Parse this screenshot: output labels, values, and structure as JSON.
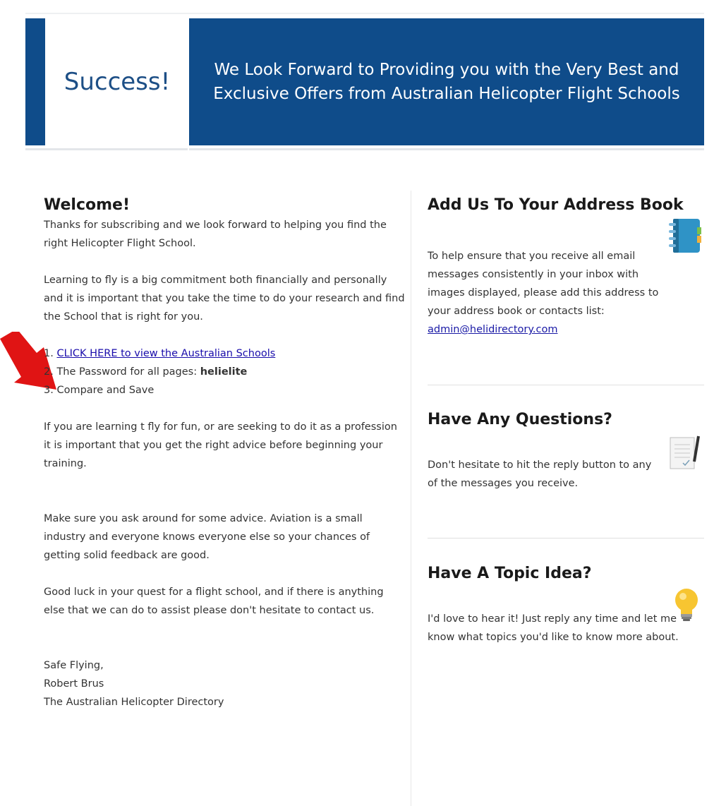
{
  "header": {
    "success": "Success!",
    "banner": "We Look Forward to Providing you with the Very Best and Exclusive Offers from Australian Helicopter Flight Schools"
  },
  "left": {
    "heading": "Welcome!",
    "p1": "Thanks for subscribing and we look forward to helping you find the right Helicopter Flight School.",
    "p2": "Learning to fly is a big commitment both financially and personally and it is important that you take the time to do your research and find the School that is right for you.",
    "list": {
      "item1_num": "1. ",
      "item1_link": "CLICK HERE to view the Australian Schools",
      "item2_text": "2. The Password for all pages: ",
      "item2_bold": "helielite",
      "item3": "3. Compare and Save"
    },
    "p3": "If you are learning t fly for fun, or are seeking to do it as a profession it is important that you get the right advice before beginning your training.",
    "p4": "Make sure you ask around for some advice. Aviation is a small industry and everyone knows everyone else so your chances of getting solid feedback are good.",
    "p5": "Good luck in your quest for a flight school, and if there is anything else that we can do to assist please don't hesitate to contact us.",
    "sign1": "Safe Flying,",
    "sign2": "Robert Brus",
    "sign3": "The Australian Helicopter Directory"
  },
  "right": {
    "address": {
      "heading": "Add Us To Your Address Book",
      "text": "To help ensure that you receive all email messages consistently in your inbox with images displayed, please add this address to your address book or contacts list: ",
      "email": "admin@helidirectory.com",
      "icon": "address-book-icon"
    },
    "questions": {
      "heading": "Have Any Questions?",
      "text": "Don't hesitate to hit the reply button to any of the messages you receive.",
      "icon": "notepad-icon"
    },
    "topic": {
      "heading": "Have A Topic Idea?",
      "text": "I'd love to hear it! Just reply any time and let me know what topics you'd like to know more about.",
      "icon": "lightbulb-icon"
    }
  },
  "colors": {
    "brand_blue": "#0f4c8a",
    "arrow_red": "#e01414"
  }
}
